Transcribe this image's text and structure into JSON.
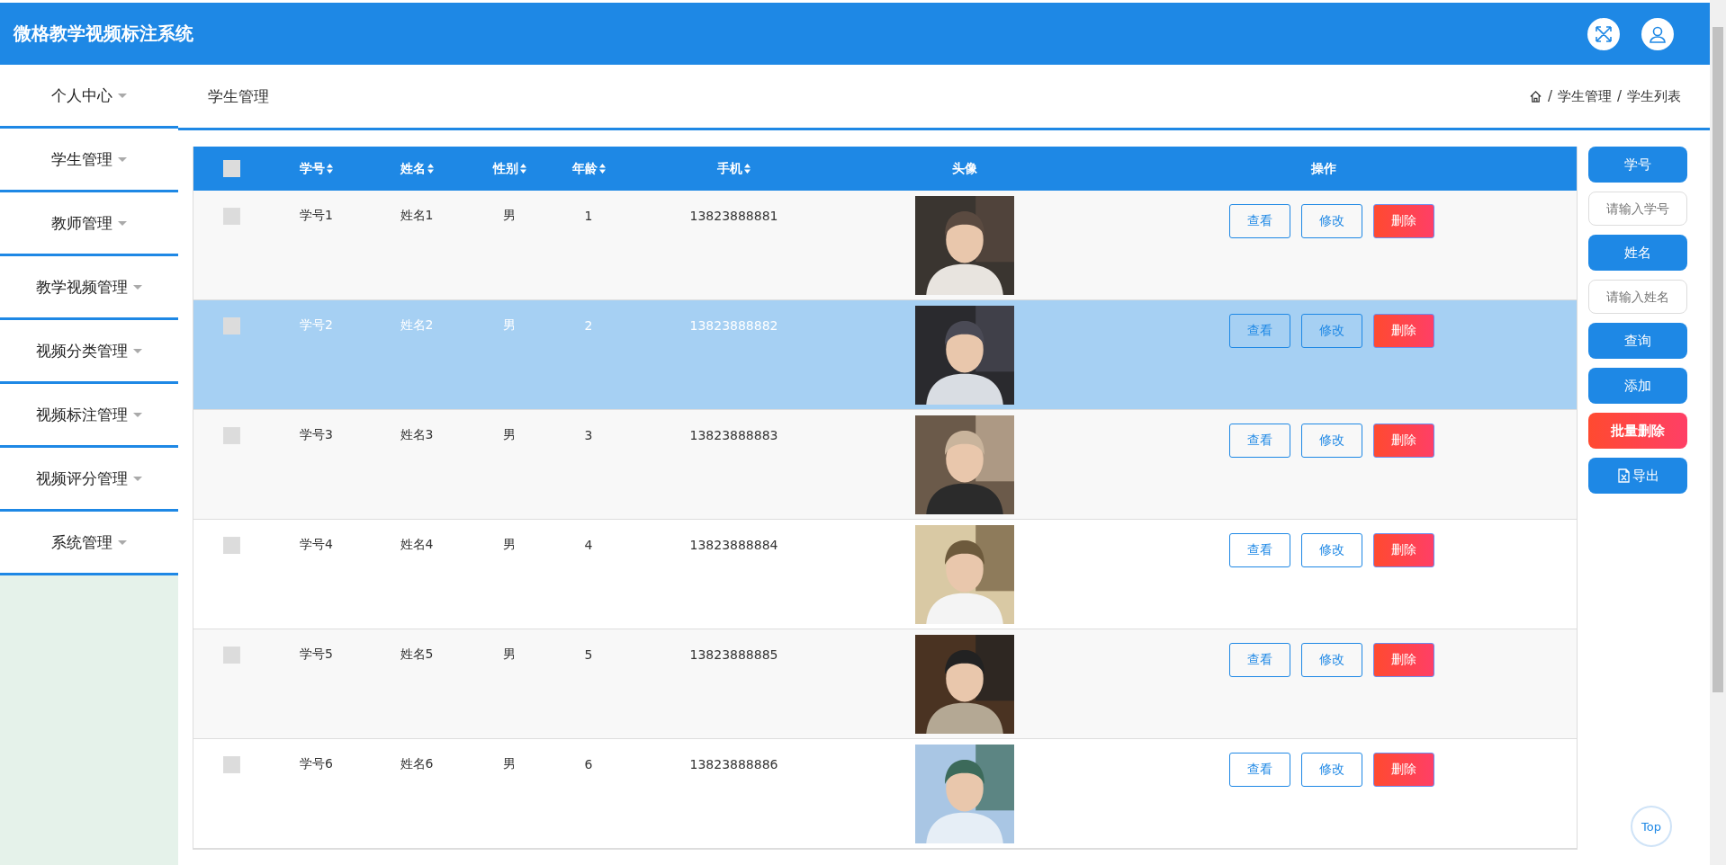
{
  "header": {
    "title": "微格教学视频标注系统"
  },
  "sidebar": {
    "items": [
      {
        "label": "个人中心"
      },
      {
        "label": "学生管理"
      },
      {
        "label": "教师管理"
      },
      {
        "label": "教学视频管理"
      },
      {
        "label": "视频分类管理"
      },
      {
        "label": "视频标注管理"
      },
      {
        "label": "视频评分管理"
      },
      {
        "label": "系统管理"
      }
    ]
  },
  "page_title": "学生管理",
  "breadcrumb": [
    {
      "separator": "/",
      "label": "学生管理"
    },
    {
      "separator": "/",
      "label": "学生列表"
    }
  ],
  "table": {
    "all_checked": false,
    "columns": [
      {
        "label": "学号",
        "sortable": true
      },
      {
        "label": "姓名",
        "sortable": true
      },
      {
        "label": "性别",
        "sortable": true
      },
      {
        "label": "年龄",
        "sortable": true
      },
      {
        "label": "手机",
        "sortable": true
      },
      {
        "label": "头像",
        "sortable": false
      },
      {
        "label": "操作",
        "sortable": false
      }
    ],
    "rows": [
      {
        "cells": [
          "学号1",
          "姓名1",
          "男",
          "1",
          "13823888881"
        ],
        "checked": false,
        "selected": false,
        "avatar": {
          "kind": "picture"
        },
        "actions": [
          {
            "label": "查看",
            "kind": "view"
          },
          {
            "label": "修改",
            "kind": "edit"
          },
          {
            "label": "删除",
            "kind": "delete"
          }
        ]
      },
      {
        "cells": [
          "学号2",
          "姓名2",
          "男",
          "2",
          "13823888882"
        ],
        "checked": false,
        "selected": true,
        "avatar": {
          "kind": "picture"
        },
        "actions": [
          {
            "label": "查看",
            "kind": "view"
          },
          {
            "label": "修改",
            "kind": "edit"
          },
          {
            "label": "删除",
            "kind": "delete"
          }
        ]
      },
      {
        "cells": [
          "学号3",
          "姓名3",
          "男",
          "3",
          "13823888883"
        ],
        "checked": false,
        "selected": false,
        "avatar": {
          "kind": "picture"
        },
        "actions": [
          {
            "label": "查看",
            "kind": "view"
          },
          {
            "label": "修改",
            "kind": "edit"
          },
          {
            "label": "删除",
            "kind": "delete"
          }
        ]
      },
      {
        "cells": [
          "学号4",
          "姓名4",
          "男",
          "4",
          "13823888884"
        ],
        "checked": false,
        "selected": false,
        "avatar": {
          "kind": "picture"
        },
        "actions": [
          {
            "label": "查看",
            "kind": "view"
          },
          {
            "label": "修改",
            "kind": "edit"
          },
          {
            "label": "删除",
            "kind": "delete"
          }
        ]
      },
      {
        "cells": [
          "学号5",
          "姓名5",
          "男",
          "5",
          "13823888885"
        ],
        "checked": false,
        "selected": false,
        "avatar": {
          "kind": "picture"
        },
        "actions": [
          {
            "label": "查看",
            "kind": "view"
          },
          {
            "label": "修改",
            "kind": "edit"
          },
          {
            "label": "删除",
            "kind": "delete"
          }
        ]
      },
      {
        "cells": [
          "学号6",
          "姓名6",
          "男",
          "6",
          "13823888886"
        ],
        "checked": false,
        "selected": false,
        "avatar": {
          "kind": "picture"
        },
        "actions": [
          {
            "label": "查看",
            "kind": "view"
          },
          {
            "label": "修改",
            "kind": "edit"
          },
          {
            "label": "删除",
            "kind": "delete"
          }
        ]
      }
    ]
  },
  "search_panel": [
    {
      "kind": "label",
      "text": "学号"
    },
    {
      "kind": "input",
      "placeholder": "请输入学号"
    },
    {
      "kind": "label",
      "text": "姓名"
    },
    {
      "kind": "input",
      "placeholder": "请输入姓名"
    },
    {
      "kind": "button",
      "text": "查询"
    },
    {
      "kind": "button",
      "text": "添加"
    },
    {
      "kind": "danger",
      "text": "批量删除"
    },
    {
      "kind": "export",
      "text": "导出"
    }
  ],
  "top_button": "Top"
}
